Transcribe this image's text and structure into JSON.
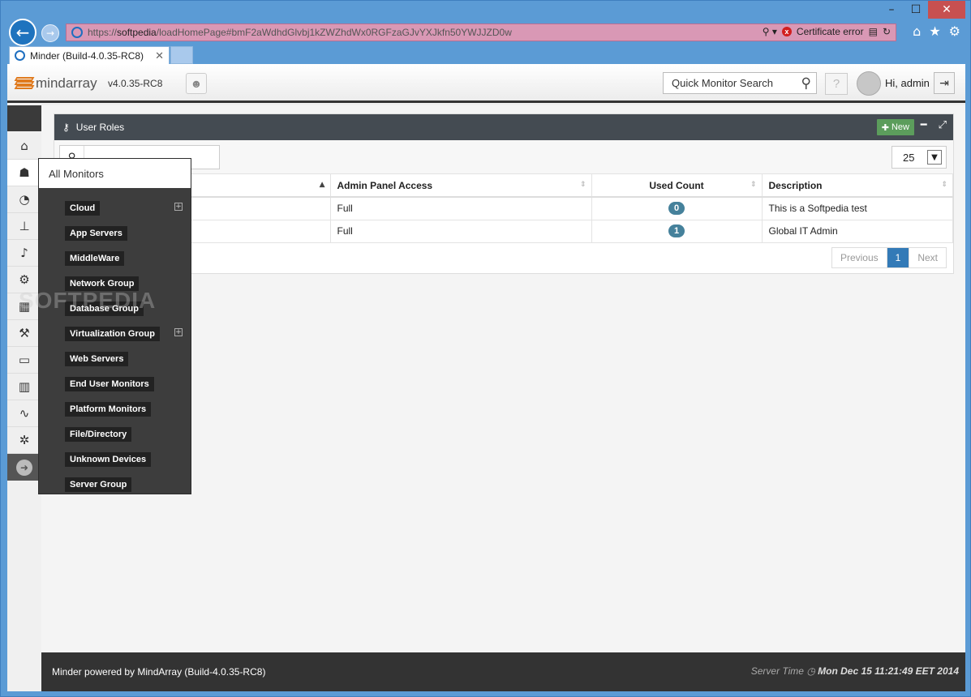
{
  "browser": {
    "url_prefix": "https://",
    "url_host": "softpedia",
    "url_path": "/loadHomePage#bmF2aWdhdGlvbj1kZWZhdWx0RGFzaGJvYXJkfn50YWJJZD0w",
    "cert_error": "Certificate error",
    "tab_title": "Minder (Build-4.0.35-RC8)"
  },
  "header": {
    "logo_text": "mindarray",
    "version": "v4.0.35-RC8",
    "search_placeholder": "Quick Monitor Search",
    "help_label": "?",
    "greeting": "Hi, admin"
  },
  "panel": {
    "title": "User Roles",
    "new_label": "New",
    "page_size": "25",
    "columns": [
      "",
      "Admin Panel Access",
      "Used Count",
      "Description"
    ],
    "rows": [
      {
        "admin": "Full",
        "count": "0",
        "description": "This is a Softpedia test"
      },
      {
        "admin": "Full",
        "count": "1",
        "description": "Global IT Admin"
      }
    ],
    "pager": {
      "prev": "Previous",
      "current": "1",
      "next": "Next"
    }
  },
  "dropdown": {
    "title": "All Monitors",
    "items": [
      {
        "label": "Cloud",
        "expandable": true
      },
      {
        "label": "App Servers",
        "expandable": false
      },
      {
        "label": "MiddleWare",
        "expandable": false
      },
      {
        "label": "Network Group",
        "expandable": false
      },
      {
        "label": "Database Group",
        "expandable": false
      },
      {
        "label": "Virtualization Group",
        "expandable": true
      },
      {
        "label": "Web Servers",
        "expandable": false
      },
      {
        "label": "End User Monitors",
        "expandable": false
      },
      {
        "label": "Platform Monitors",
        "expandable": false
      },
      {
        "label": "File/Directory",
        "expandable": false
      },
      {
        "label": "Unknown Devices",
        "expandable": false
      },
      {
        "label": "Server Group",
        "expandable": false
      }
    ]
  },
  "rail": {
    "icons": [
      "home-icon",
      "users-icon",
      "dashboard-icon",
      "topology-icon",
      "bell-icon",
      "gear-icon",
      "calculator-icon",
      "wrench-icon",
      "monitor-icon",
      "calendar-icon",
      "chart-icon",
      "gears-icon"
    ]
  },
  "footer": {
    "powered_by": "Minder powered by MindArray (Build-4.0.35-RC8)",
    "server_time_label": "Server Time",
    "server_time": "Mon Dec 15 11:21:49 EET 2014"
  },
  "watermark": "SOFTPEDIA",
  "colors": {
    "accent": "#337ab7",
    "new_button": "#5c9d5c",
    "badge": "#45819b",
    "url_bar_error": "#d998b5"
  }
}
